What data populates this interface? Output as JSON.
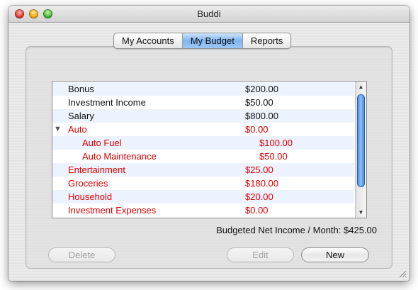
{
  "window": {
    "title": "Buddi"
  },
  "tabs": [
    {
      "label": "My Accounts",
      "active": false
    },
    {
      "label": "My Budget",
      "active": true
    },
    {
      "label": "Reports",
      "active": false
    }
  ],
  "budget": {
    "rows": [
      {
        "name": "Bonus",
        "amount": "$200.00",
        "color": "#111111",
        "indent": 0
      },
      {
        "name": "Investment Income",
        "amount": "$50.00",
        "color": "#111111",
        "indent": 0
      },
      {
        "name": "Salary",
        "amount": "$800.00",
        "color": "#111111",
        "indent": 0
      },
      {
        "name": "Auto",
        "amount": "$0.00",
        "color": "#e00000",
        "indent": 0,
        "expanded": true
      },
      {
        "name": "Auto Fuel",
        "amount": "$100.00",
        "color": "#e00000",
        "indent": 1
      },
      {
        "name": "Auto Maintenance",
        "amount": "$50.00",
        "color": "#e00000",
        "indent": 1
      },
      {
        "name": "Entertainment",
        "amount": "$25.00",
        "color": "#e00000",
        "indent": 0
      },
      {
        "name": "Groceries",
        "amount": "$180.00",
        "color": "#e00000",
        "indent": 0
      },
      {
        "name": "Household",
        "amount": "$20.00",
        "color": "#e00000",
        "indent": 0
      },
      {
        "name": "Investment Expenses",
        "amount": "$0.00",
        "color": "#e00000",
        "indent": 0
      }
    ],
    "summary": "Budgeted Net Income / Month: $425.00"
  },
  "buttons": {
    "delete": {
      "label": "Delete",
      "enabled": false
    },
    "edit": {
      "label": "Edit",
      "enabled": false
    },
    "new": {
      "label": "New",
      "enabled": true
    }
  },
  "icons": {
    "close": "close-icon",
    "minimize": "minimize-icon",
    "zoom": "zoom-icon",
    "disclosure": "triangle-down-icon",
    "scroll_up": "arrow-up-icon",
    "scroll_down": "arrow-down-icon",
    "resize": "resize-grip-icon"
  }
}
